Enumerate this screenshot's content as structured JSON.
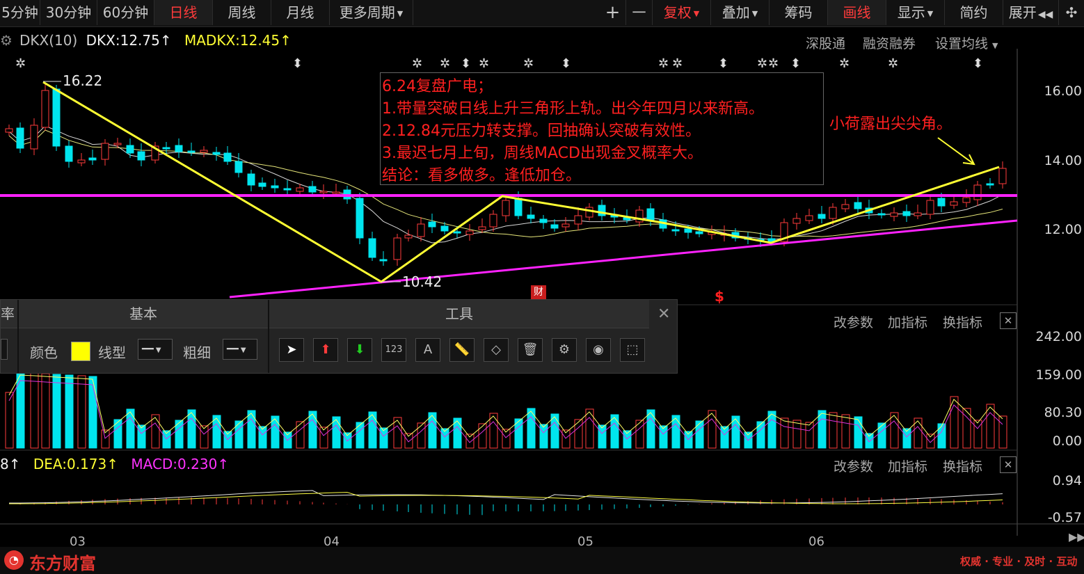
{
  "toolbar": {
    "periods": [
      "5分钟",
      "30分钟",
      "60分钟",
      "日线",
      "周线",
      "月线",
      "更多周期"
    ],
    "active_period": "日线",
    "right_buttons": [
      "+",
      "一",
      "复权",
      "叠加",
      "筹码",
      "画线",
      "显示",
      "简约",
      "展开"
    ],
    "active_right": "画线",
    "fuquan_color": "#ff3b3b"
  },
  "indicator": {
    "name": "DKX(10)",
    "dkx": "DKX:12.75",
    "madkx": "MADKX:12.45",
    "arrow": "↑",
    "links": [
      "深股通",
      "融资融券",
      "设置均线"
    ]
  },
  "price_axis": [
    "16.00",
    "14.00",
    "12.00"
  ],
  "annotations": {
    "high": "16.22",
    "low": "10.42",
    "note_lines": [
      "6.24复盘广电；",
      "1.带量突破日线上升三角形上轨。出今年四月以来新高。",
      "2.12.84元压力转支撑。回抽确认突破有效性。",
      "3.最迟七月上旬，周线MACD出现金叉概率大。",
      "结论：看多做多。逢低加仓。"
    ],
    "right_note": "小荷露出尖尖角。",
    "badge_cai": "财",
    "badge_s": "$"
  },
  "toolbox": {
    "tab_basic": "基本",
    "tab_tools": "工具",
    "color_label": "颜色",
    "line_type_label": "线型",
    "thickness_label": "粗细",
    "color_value": "#ffff00",
    "tab_prefix": "率"
  },
  "volume_panel": {
    "actions": [
      "改参数",
      "加指标",
      "换指标"
    ],
    "axis": [
      "242.00",
      "159.00",
      "80.30",
      "0.00"
    ]
  },
  "macd_panel": {
    "dif_fragment": "8",
    "dea": "DEA:0.173",
    "macd": "MACD:0.230",
    "arrow": "↑",
    "actions": [
      "改参数",
      "加指标",
      "换指标"
    ],
    "axis": [
      "0.94",
      "-0.57"
    ]
  },
  "dates": [
    "03",
    "04",
    "05",
    "06"
  ],
  "footer": {
    "brand": "东方财富",
    "slogan": "权威 · 专业 · 及时 · 互动"
  },
  "colors": {
    "up": "#ff3b3b",
    "down": "#00e5ee",
    "trend": "#ffff33",
    "support": "#ff22ff",
    "ma_white": "#dddddd",
    "ma_yellow": "#f0f080"
  }
}
